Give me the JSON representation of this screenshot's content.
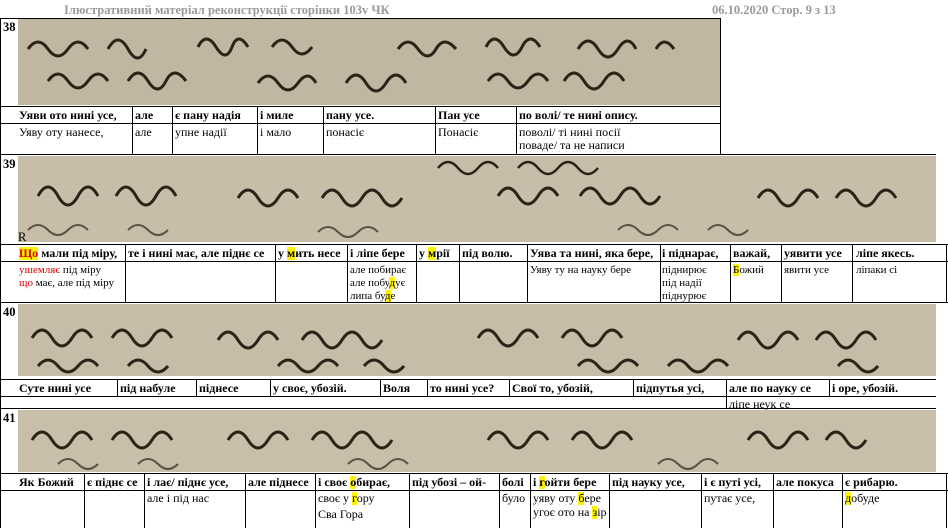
{
  "header": {
    "left": "Ілюстративний матеріал  реконструкції сторінки 103v ЧК",
    "right": "06.10.2020  Стор. 9 з 13"
  },
  "colors": {
    "highlight": "#fff200",
    "spell_underline": "#d00000",
    "red_text": "#e00000",
    "parchment": "#c9bfae",
    "ink": "#2a1e14"
  },
  "sections": [
    {
      "number": "38",
      "top_row": [
        "Уяви ото нині усе,",
        "але",
        "є пану надія",
        "і миле",
        "пану усе.",
        "Пан усе",
        "по волі/ те нині опису."
      ],
      "bottom_row": [
        "Уяву оту нанесе,",
        "але",
        "упне надії",
        "і мало",
        "понасіє",
        "Понасіє",
        "поволі/ ті нині посії",
        "поваде/ та не написи"
      ]
    },
    {
      "number": "39",
      "marker": "R",
      "top_row": [
        "Що",
        " мали під міру,",
        "те і нині має, але піднє се",
        "у ",
        "м",
        "ить несе",
        "і ліпе бере",
        "у ",
        "м",
        "рії",
        "під волю.",
        "Уява та нині, яка бере,",
        "і піднарає,",
        "важай,",
        "уявити усе",
        "ліпе якесь."
      ],
      "bottom_row": [
        "ушемляє",
        " під міру",
        "що",
        " має, але під міру",
        "але побирає",
        "але побу",
        "д",
        "ує",
        "липа бу",
        "д",
        "е",
        "Уяву ту на науку бере",
        "піднирює",
        "під надії",
        "піднурює",
        "Б",
        "ожий",
        "явити усе",
        "ліпаки сі"
      ]
    },
    {
      "number": "40",
      "top_row": [
        "Суте нині усе",
        "під набуле",
        "піднесе",
        "у своє, убозій.",
        "Воля",
        "то нині усе?",
        "Свої то, убозій,",
        "підпутья усі,",
        "але по науку се",
        "і оре, убозій."
      ],
      "bottom_row": [
        "ліпе неук се"
      ]
    },
    {
      "number": "41",
      "top_row": [
        "Як Божий",
        "є піднє се",
        "і лає/ піднє усе,",
        "але піднесе",
        "і своє ",
        "о",
        "бирає,",
        "під убозі – ой-",
        "болі",
        "і ",
        "г",
        "ойти бере",
        "під науку усе,",
        "і є путі усі,",
        "але покуса",
        "є рибарю."
      ],
      "bottom_row": [
        "але і під нас",
        "своє у ",
        "г",
        "ору",
        "Сва Гора",
        "було",
        "уяву оту ",
        "б",
        "ере",
        "угоє",
        " ото на ",
        "з",
        "ір",
        "путає усе,",
        "д",
        "обуде"
      ]
    }
  ]
}
